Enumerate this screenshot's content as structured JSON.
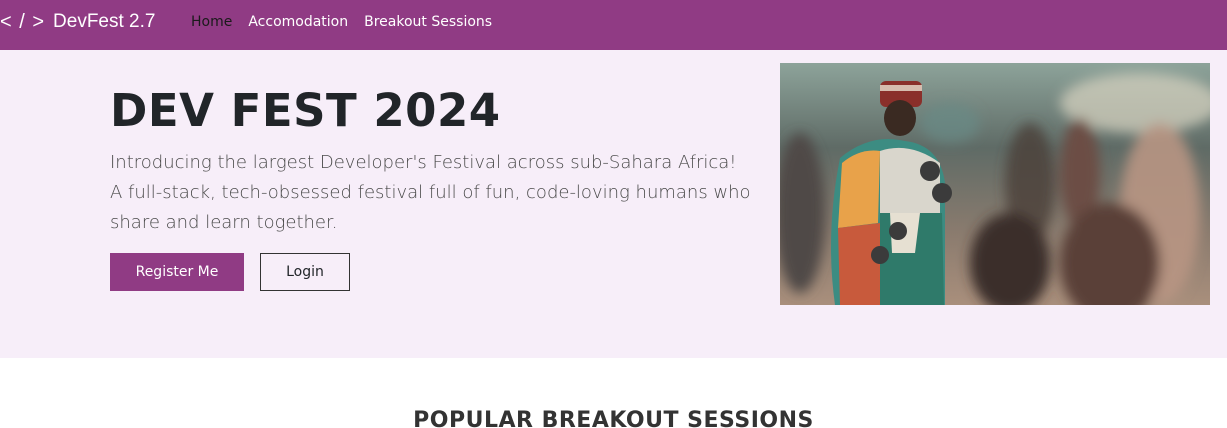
{
  "navbar": {
    "brand_icon": "< / >",
    "brand_name": "DevFest 2.7",
    "links": [
      {
        "label": "Home",
        "active": true
      },
      {
        "label": "Accomodation",
        "active": false
      },
      {
        "label": "Breakout Sessions",
        "active": false
      }
    ]
  },
  "hero": {
    "title": "DEV FEST 2024",
    "lead_lines": [
      "Introducing the largest Developer's Festival across sub-Sahara Africa!",
      "A full-stack, tech-obsessed festival full of fun, code-loving humans who",
      "share and learn together."
    ],
    "register_label": "Register Me",
    "login_label": "Login"
  },
  "sections": {
    "popular_title": "POPULAR BREAKOUT SESSIONS"
  },
  "colors": {
    "brand": "#903b84",
    "hero_bg": "#f7eef9"
  }
}
